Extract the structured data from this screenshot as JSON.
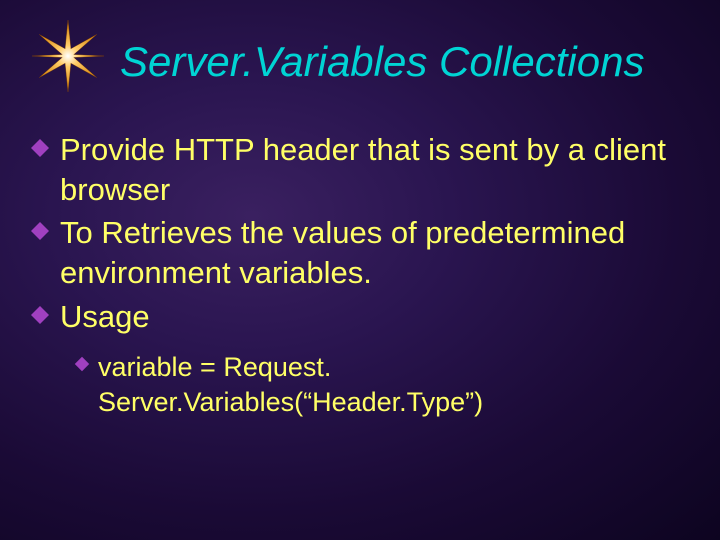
{
  "title": "Server.Variables Collections",
  "bullets": [
    {
      "text": "Provide HTTP header that is sent by a client browser"
    },
    {
      "text": "To Retrieves the values of predetermined environment variables."
    },
    {
      "text": "Usage"
    }
  ],
  "subbullets": [
    {
      "text": "variable = Request. Server.Variables(“Header.Type”)"
    }
  ]
}
